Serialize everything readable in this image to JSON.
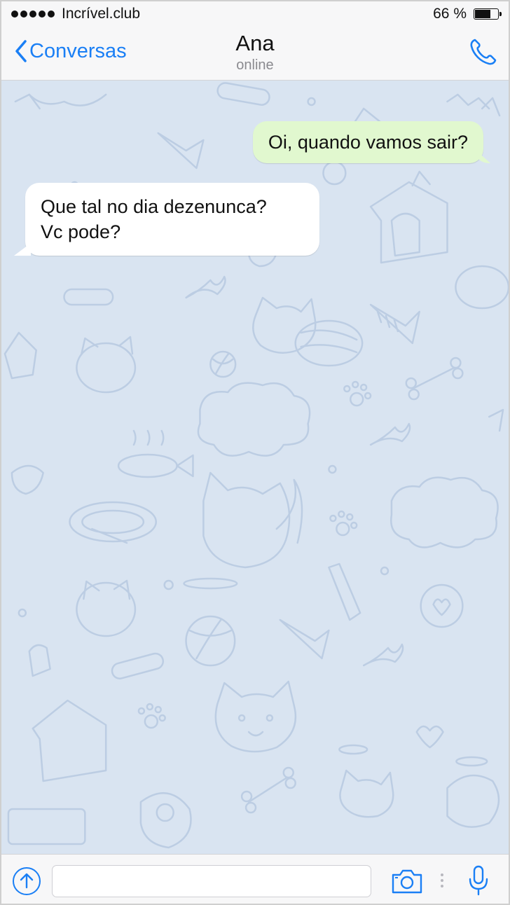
{
  "status_bar": {
    "carrier": "Incrível.club",
    "battery": "66 %"
  },
  "nav": {
    "back_label": "Conversas",
    "contact_name": "Ana",
    "contact_status": "online",
    "call_icon": "phone-icon"
  },
  "messages": [
    {
      "direction": "outgoing",
      "lines": [
        "Oi, quando vamos sair?"
      ]
    },
    {
      "direction": "incoming",
      "lines": [
        "Que tal no dia dezenunca?",
        "Vc pode?"
      ]
    }
  ],
  "input_bar": {
    "attach_icon": "upload-icon",
    "message_value": "",
    "camera_icon": "camera-icon",
    "mic_icon": "microphone-icon"
  },
  "colors": {
    "accent": "#1a7ff5",
    "chat_background": "#d9e4f1",
    "outgoing_bubble": "#e1f8cf",
    "incoming_bubble": "#ffffff"
  }
}
